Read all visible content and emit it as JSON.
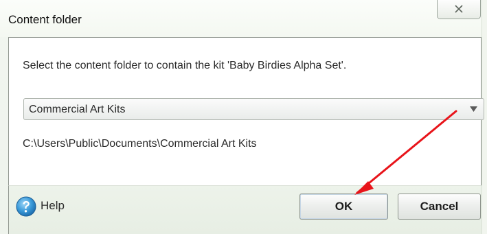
{
  "window": {
    "title": "Content folder",
    "close_glyph": "✕"
  },
  "dialog": {
    "prompt": "Select the content folder to contain the kit 'Baby Birdies Alpha Set'.",
    "folder_select": {
      "selected": "Commercial Art Kits"
    },
    "folder_path": "C:\\Users\\Public\\Documents\\Commercial Art Kits"
  },
  "footer": {
    "help_label": "Help",
    "ok_label": "OK",
    "cancel_label": "Cancel"
  },
  "icons": {
    "close": "close-icon",
    "dropdown": "chevron-down-icon",
    "help": "help-icon",
    "annotation": "red-arrow"
  },
  "colors": {
    "annotation_arrow": "#e8141a",
    "help_icon": "#3a9ad9"
  }
}
